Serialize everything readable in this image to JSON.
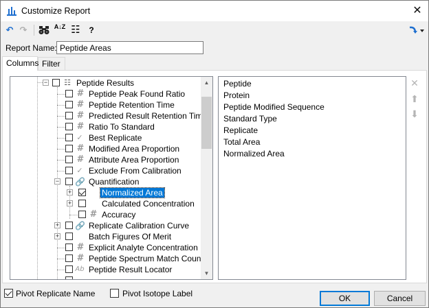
{
  "window": {
    "title": "Customize Report",
    "close_glyph": "✕"
  },
  "toolbar": {
    "undo_icon": "↶",
    "redo_icon": "↷",
    "find_icon": "find-binoculars-icon",
    "sort_icon": "A↓Z",
    "columns_icon": "☷",
    "help_label": "?",
    "share_icon": "share-icon"
  },
  "report_name": {
    "label": "Report Name:",
    "value": "Peptide Areas"
  },
  "tabs": [
    {
      "label": "Columns",
      "active": true
    },
    {
      "label": "Filter",
      "active": false
    }
  ],
  "tree": {
    "items": [
      {
        "label": "Peptide Results",
        "icon": "table-icon",
        "checked": false,
        "expander": "minus"
      },
      {
        "label": "Peptide Peak Found Ratio",
        "icon": "number-icon",
        "checked": false
      },
      {
        "label": "Peptide Retention Time",
        "icon": "number-icon",
        "checked": false
      },
      {
        "label": "Predicted Result Retention Time",
        "icon": "number-icon",
        "checked": false
      },
      {
        "label": "Ratio To Standard",
        "icon": "number-icon",
        "checked": false
      },
      {
        "label": "Best Replicate",
        "icon": "checkmark-field-icon",
        "checked": false
      },
      {
        "label": "Modified Area Proportion",
        "icon": "number-icon",
        "checked": false
      },
      {
        "label": "Attribute Area Proportion",
        "icon": "number-icon",
        "checked": false
      },
      {
        "label": "Exclude From Calibration",
        "icon": "checkmark-field-icon",
        "checked": false
      },
      {
        "label": "Quantification",
        "icon": "link-icon",
        "checked": false,
        "expander": "minus"
      },
      {
        "label": "Normalized Area",
        "icon": "",
        "checked": true,
        "expander": "plus",
        "selected": true
      },
      {
        "label": "Calculated Concentration",
        "icon": "",
        "checked": false,
        "expander": "plus"
      },
      {
        "label": "Accuracy",
        "icon": "number-icon",
        "checked": false
      },
      {
        "label": "Replicate Calibration Curve",
        "icon": "link-icon",
        "checked": false,
        "expander": "plus"
      },
      {
        "label": "Batch Figures Of Merit",
        "icon": "",
        "checked": false,
        "expander": "plus"
      },
      {
        "label": "Explicit Analyte Concentration",
        "icon": "number-icon",
        "checked": false
      },
      {
        "label": "Peptide Spectrum Match Count",
        "icon": "number-icon",
        "checked": false
      },
      {
        "label": "Peptide Result Locator",
        "icon": "text-field-icon",
        "checked": false
      }
    ]
  },
  "selected_columns": [
    "Peptide",
    "Protein",
    "Peptide Modified Sequence",
    "Standard Type",
    "Replicate",
    "Total Area",
    "Normalized Area"
  ],
  "side_buttons": {
    "remove_icon": "✕",
    "up_icon": "⬆",
    "down_icon": "⬇"
  },
  "options": {
    "pivot_replicate": {
      "label": "Pivot Replicate Name",
      "checked": true
    },
    "pivot_isotope": {
      "label": "Pivot Isotope Label",
      "checked": false
    }
  },
  "buttons": {
    "ok": "OK",
    "cancel": "Cancel"
  },
  "colors": {
    "selection": "#0078d7",
    "accent_blue": "#1e6fd0"
  }
}
